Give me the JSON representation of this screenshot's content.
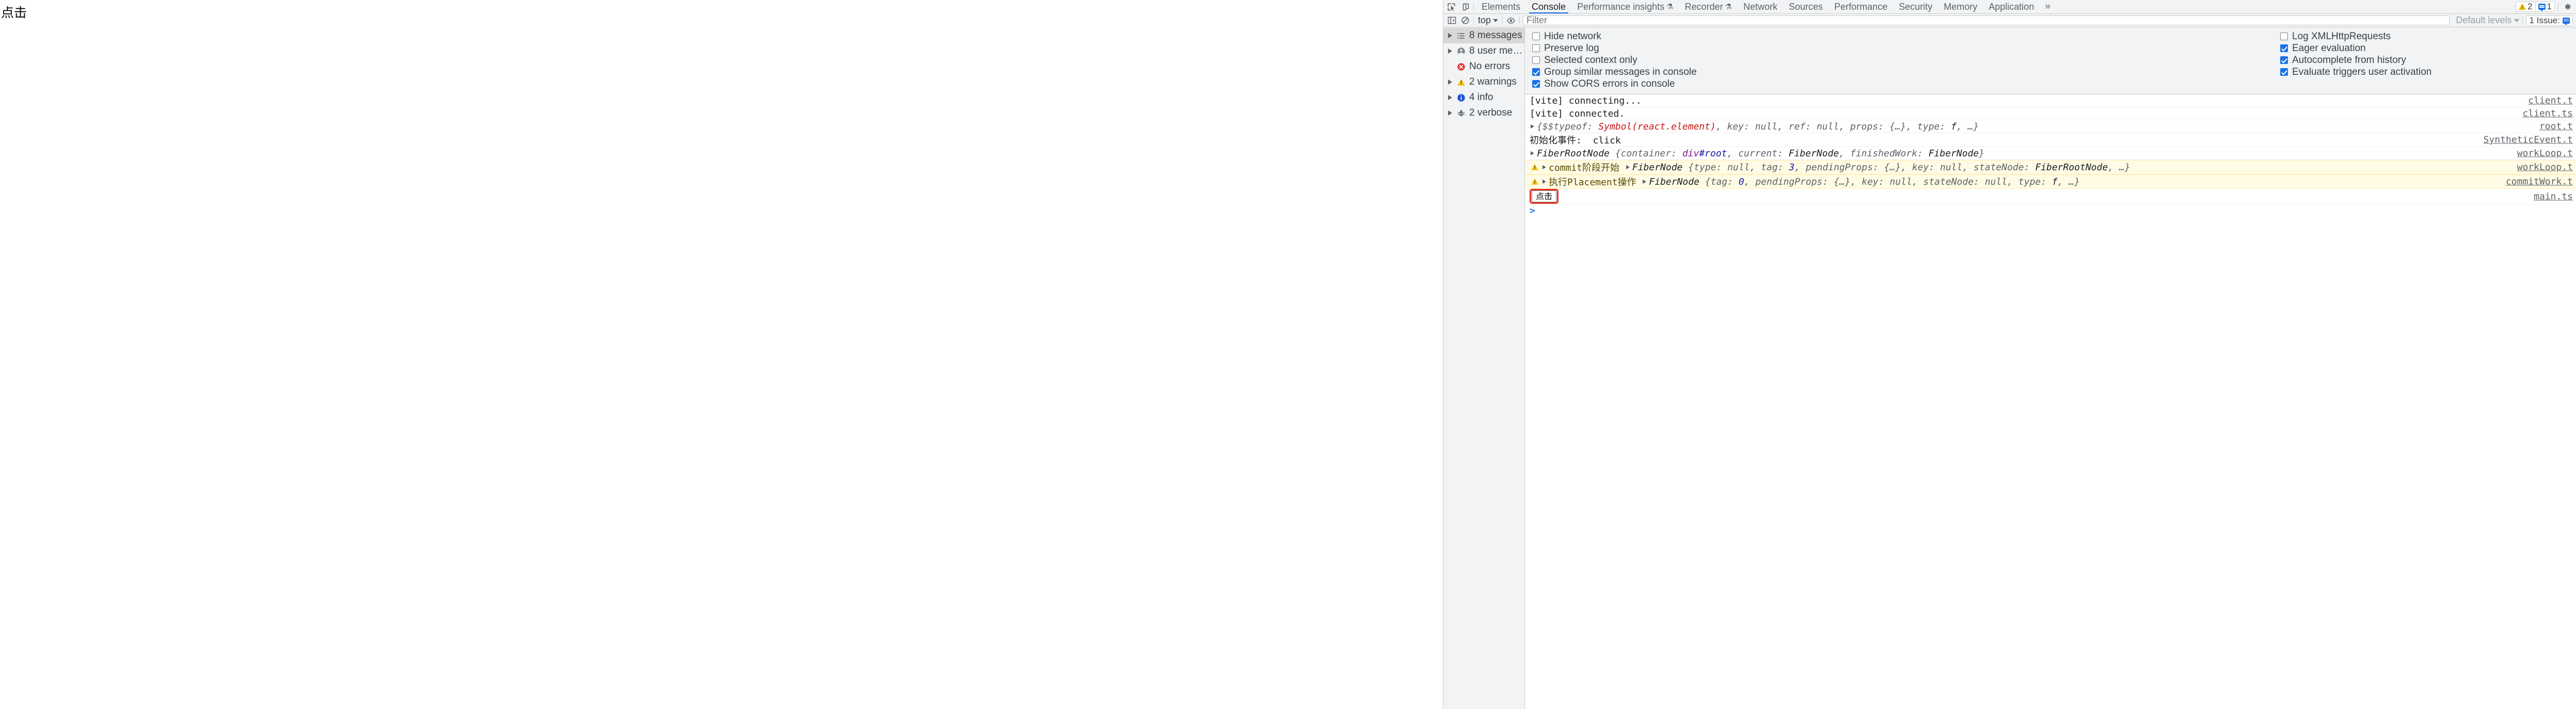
{
  "page": {
    "button_label": "点击"
  },
  "devtools": {
    "tabstrip": {
      "inspect_icon": "inspect-cursor-icon",
      "device_icon": "device-toolbar-icon",
      "tabs": [
        {
          "label": "Elements",
          "active": false,
          "flask": ""
        },
        {
          "label": "Console",
          "active": true,
          "flask": ""
        },
        {
          "label": "Performance insights",
          "active": false,
          "flask": "⚗"
        },
        {
          "label": "Recorder",
          "active": false,
          "flask": "⚗"
        },
        {
          "label": "Network",
          "active": false,
          "flask": ""
        },
        {
          "label": "Sources",
          "active": false,
          "flask": ""
        },
        {
          "label": "Performance",
          "active": false,
          "flask": ""
        },
        {
          "label": "Security",
          "active": false,
          "flask": ""
        },
        {
          "label": "Memory",
          "active": false,
          "flask": ""
        },
        {
          "label": "Application",
          "active": false,
          "flask": ""
        }
      ],
      "more_tabs_label": "»",
      "warning_count": "2",
      "issue_count": "1",
      "settings_icon": "gear-icon"
    },
    "toolbar": {
      "sidebar_toggle_icon": "show-console-sidebar-icon",
      "clear_icon": "clear-console-icon",
      "context_label": "top",
      "eye_icon": "live-expression-icon",
      "filter_placeholder": "Filter",
      "filter_value": "",
      "levels_label": "Default levels",
      "issues_label": "1 Issue:"
    },
    "sidebar": {
      "items": [
        {
          "label": "8 messages",
          "icon": "list-icon",
          "selected": true,
          "expandable": true
        },
        {
          "label": "8 user mes…",
          "icon": "user-icon",
          "selected": false,
          "expandable": true
        },
        {
          "label": "No errors",
          "icon": "error-icon",
          "selected": false,
          "expandable": false
        },
        {
          "label": "2 warnings",
          "icon": "warning-icon",
          "selected": false,
          "expandable": true
        },
        {
          "label": "4 info",
          "icon": "info-icon",
          "selected": false,
          "expandable": true
        },
        {
          "label": "2 verbose",
          "icon": "verbose-bug-icon",
          "selected": false,
          "expandable": true
        }
      ]
    },
    "settings": {
      "left": [
        {
          "label": "Hide network",
          "checked": false
        },
        {
          "label": "Preserve log",
          "checked": false
        },
        {
          "label": "Selected context only",
          "checked": false
        },
        {
          "label": "Group similar messages in console",
          "checked": true
        },
        {
          "label": "Show CORS errors in console",
          "checked": true
        }
      ],
      "right": [
        {
          "label": "Log XMLHttpRequests",
          "checked": false
        },
        {
          "label": "Eager evaluation",
          "checked": true
        },
        {
          "label": "Autocomplete from history",
          "checked": true
        },
        {
          "label": "Evaluate triggers user activation",
          "checked": true
        }
      ]
    },
    "log": {
      "rows": [
        {
          "id": "r1",
          "level": "log",
          "expandable": false,
          "text": "[vite] connecting...",
          "source": "client.t"
        },
        {
          "id": "r2",
          "level": "log",
          "expandable": false,
          "text": "[vite] connected.",
          "source": "client.ts"
        },
        {
          "id": "r3",
          "level": "log",
          "expandable": true,
          "text": "{$$typeof: Symbol(react.element), key: null, ref: null, props: {…}, type: f, …}",
          "source": "root.t"
        },
        {
          "id": "r4",
          "level": "log",
          "expandable": false,
          "text": "初始化事件:  click",
          "source": "SyntheticEvent.t"
        },
        {
          "id": "r5",
          "level": "log",
          "expandable": true,
          "text": "FiberRootNode {container: div#root, current: FiberNode, finishedWork: FiberNode}",
          "source": "workLoop.t"
        },
        {
          "id": "r6",
          "level": "warning",
          "expandable": true,
          "text": "commit阶段开始 FiberNode {type: null, tag: 3, pendingProps: {…}, key: null, stateNode: FiberRootNode, …}",
          "source": "workLoop.t"
        },
        {
          "id": "r7",
          "level": "warning",
          "expandable": true,
          "text": "执行Placement操作 FiberNode {tag: 0, pendingProps: {…}, key: null, stateNode: null, type: f, …}",
          "source": "commitWork.t"
        },
        {
          "id": "r8",
          "level": "rendered",
          "expandable": false,
          "text": "点击",
          "source": "main.ts"
        }
      ],
      "prompt": ">"
    }
  }
}
